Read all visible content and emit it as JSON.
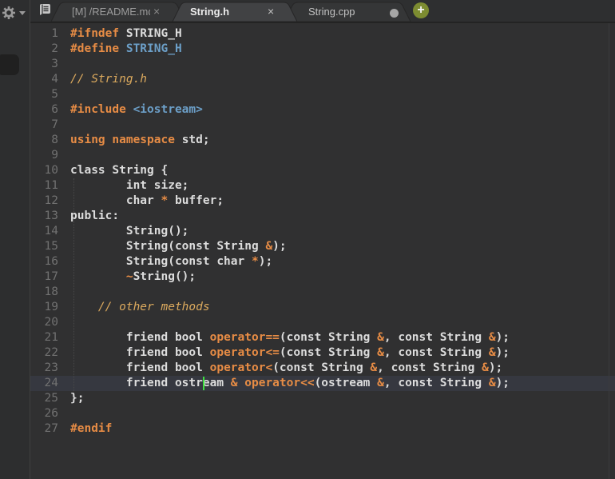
{
  "left_panel": {
    "settings_icon": "gear-icon",
    "dropdown_icon": "chevron-down-icon"
  },
  "tab_bar": {
    "file_icon": "file-list-icon",
    "tabs": [
      {
        "name": "readme",
        "label": "[M] /README.md",
        "close": "×",
        "state": "inactive",
        "truncated": true
      },
      {
        "name": "string-h",
        "label": "String.h",
        "close": "×",
        "state": "active"
      },
      {
        "name": "string-cpp",
        "label": "String.cpp",
        "modified": true,
        "state": "inactive"
      }
    ],
    "new_tab_label": "+"
  },
  "editor": {
    "language": "cpp",
    "current_line": 24,
    "caret": {
      "line": 24,
      "col": 19
    },
    "lines": [
      {
        "num": 1,
        "segs": [
          [
            "k",
            "#ifndef "
          ],
          [
            "p",
            "STRING_H"
          ]
        ]
      },
      {
        "num": 2,
        "segs": [
          [
            "k",
            "#define "
          ],
          [
            "d",
            "STRING_H"
          ]
        ]
      },
      {
        "num": 3,
        "segs": []
      },
      {
        "num": 4,
        "segs": [
          [
            "c",
            "// String.h"
          ]
        ]
      },
      {
        "num": 5,
        "segs": []
      },
      {
        "num": 6,
        "segs": [
          [
            "k",
            "#include "
          ],
          [
            "d",
            "<iostream>"
          ]
        ]
      },
      {
        "num": 7,
        "segs": []
      },
      {
        "num": 8,
        "segs": [
          [
            "k",
            "using namespace "
          ],
          [
            "p",
            "std;"
          ]
        ]
      },
      {
        "num": 9,
        "segs": []
      },
      {
        "num": 10,
        "segs": [
          [
            "p",
            "class String {"
          ]
        ]
      },
      {
        "num": 11,
        "segs": [
          [
            "p",
            "        int size;"
          ]
        ]
      },
      {
        "num": 12,
        "segs": [
          [
            "p",
            "        char "
          ],
          [
            "k",
            "*"
          ],
          [
            "p",
            " buffer;"
          ]
        ]
      },
      {
        "num": 13,
        "segs": [
          [
            "p",
            "public:"
          ]
        ]
      },
      {
        "num": 14,
        "segs": [
          [
            "p",
            "        String();"
          ]
        ]
      },
      {
        "num": 15,
        "segs": [
          [
            "p",
            "        String(const String "
          ],
          [
            "k",
            "&"
          ],
          [
            "p",
            ");"
          ]
        ]
      },
      {
        "num": 16,
        "segs": [
          [
            "p",
            "        String(const char "
          ],
          [
            "k",
            "*"
          ],
          [
            "p",
            ");"
          ]
        ]
      },
      {
        "num": 17,
        "segs": [
          [
            "p",
            "        "
          ],
          [
            "k",
            "~"
          ],
          [
            "p",
            "String();"
          ]
        ]
      },
      {
        "num": 18,
        "segs": []
      },
      {
        "num": 19,
        "segs": [
          [
            "c",
            "    // other methods"
          ]
        ]
      },
      {
        "num": 20,
        "segs": []
      },
      {
        "num": 21,
        "segs": [
          [
            "p",
            "        friend bool "
          ],
          [
            "k",
            "operator=="
          ],
          [
            "p",
            "(const String "
          ],
          [
            "k",
            "&"
          ],
          [
            "p",
            ", const String "
          ],
          [
            "k",
            "&"
          ],
          [
            "p",
            ");"
          ]
        ]
      },
      {
        "num": 22,
        "segs": [
          [
            "p",
            "        friend bool "
          ],
          [
            "k",
            "operator<="
          ],
          [
            "p",
            "(const String "
          ],
          [
            "k",
            "&"
          ],
          [
            "p",
            ", const String "
          ],
          [
            "k",
            "&"
          ],
          [
            "p",
            ");"
          ]
        ]
      },
      {
        "num": 23,
        "segs": [
          [
            "p",
            "        friend bool "
          ],
          [
            "k",
            "operator<"
          ],
          [
            "p",
            "(const String "
          ],
          [
            "k",
            "&"
          ],
          [
            "p",
            ", const String "
          ],
          [
            "k",
            "&"
          ],
          [
            "p",
            ");"
          ]
        ]
      },
      {
        "num": 24,
        "segs": [
          [
            "p",
            "        friend ostream "
          ],
          [
            "k",
            "&"
          ],
          [
            "p",
            " "
          ],
          [
            "k",
            "operator<<"
          ],
          [
            "p",
            "(ostream "
          ],
          [
            "k",
            "&"
          ],
          [
            "p",
            ", const String "
          ],
          [
            "k",
            "&"
          ],
          [
            "p",
            ");"
          ]
        ]
      },
      {
        "num": 25,
        "segs": [
          [
            "p",
            "};"
          ]
        ]
      },
      {
        "num": 26,
        "segs": []
      },
      {
        "num": 27,
        "segs": [
          [
            "k",
            "#endif"
          ]
        ]
      }
    ]
  },
  "colors": {
    "accent_orange": "#e78c45",
    "blue": "#6c9fc8",
    "comment": "#dcaa5e",
    "plain": "#dcdcdc",
    "line_number": "#717171",
    "editor_bg": "#303031",
    "left_panel_bg": "#2d2e2f",
    "tab_bar_bg": "#2e2f30",
    "tab_inactive_bg": "#353637",
    "tab_active_bg": "#414244",
    "tab_text_inactive": "#9c9c9c",
    "tab_text_cpp": "#c2c2c2",
    "tab_text_active": "#ececec",
    "current_line_bg": "#363840",
    "caret_green": "#3fe03f",
    "plus_green": "#7d8c31",
    "modified_dot": "#a6a6a6"
  }
}
